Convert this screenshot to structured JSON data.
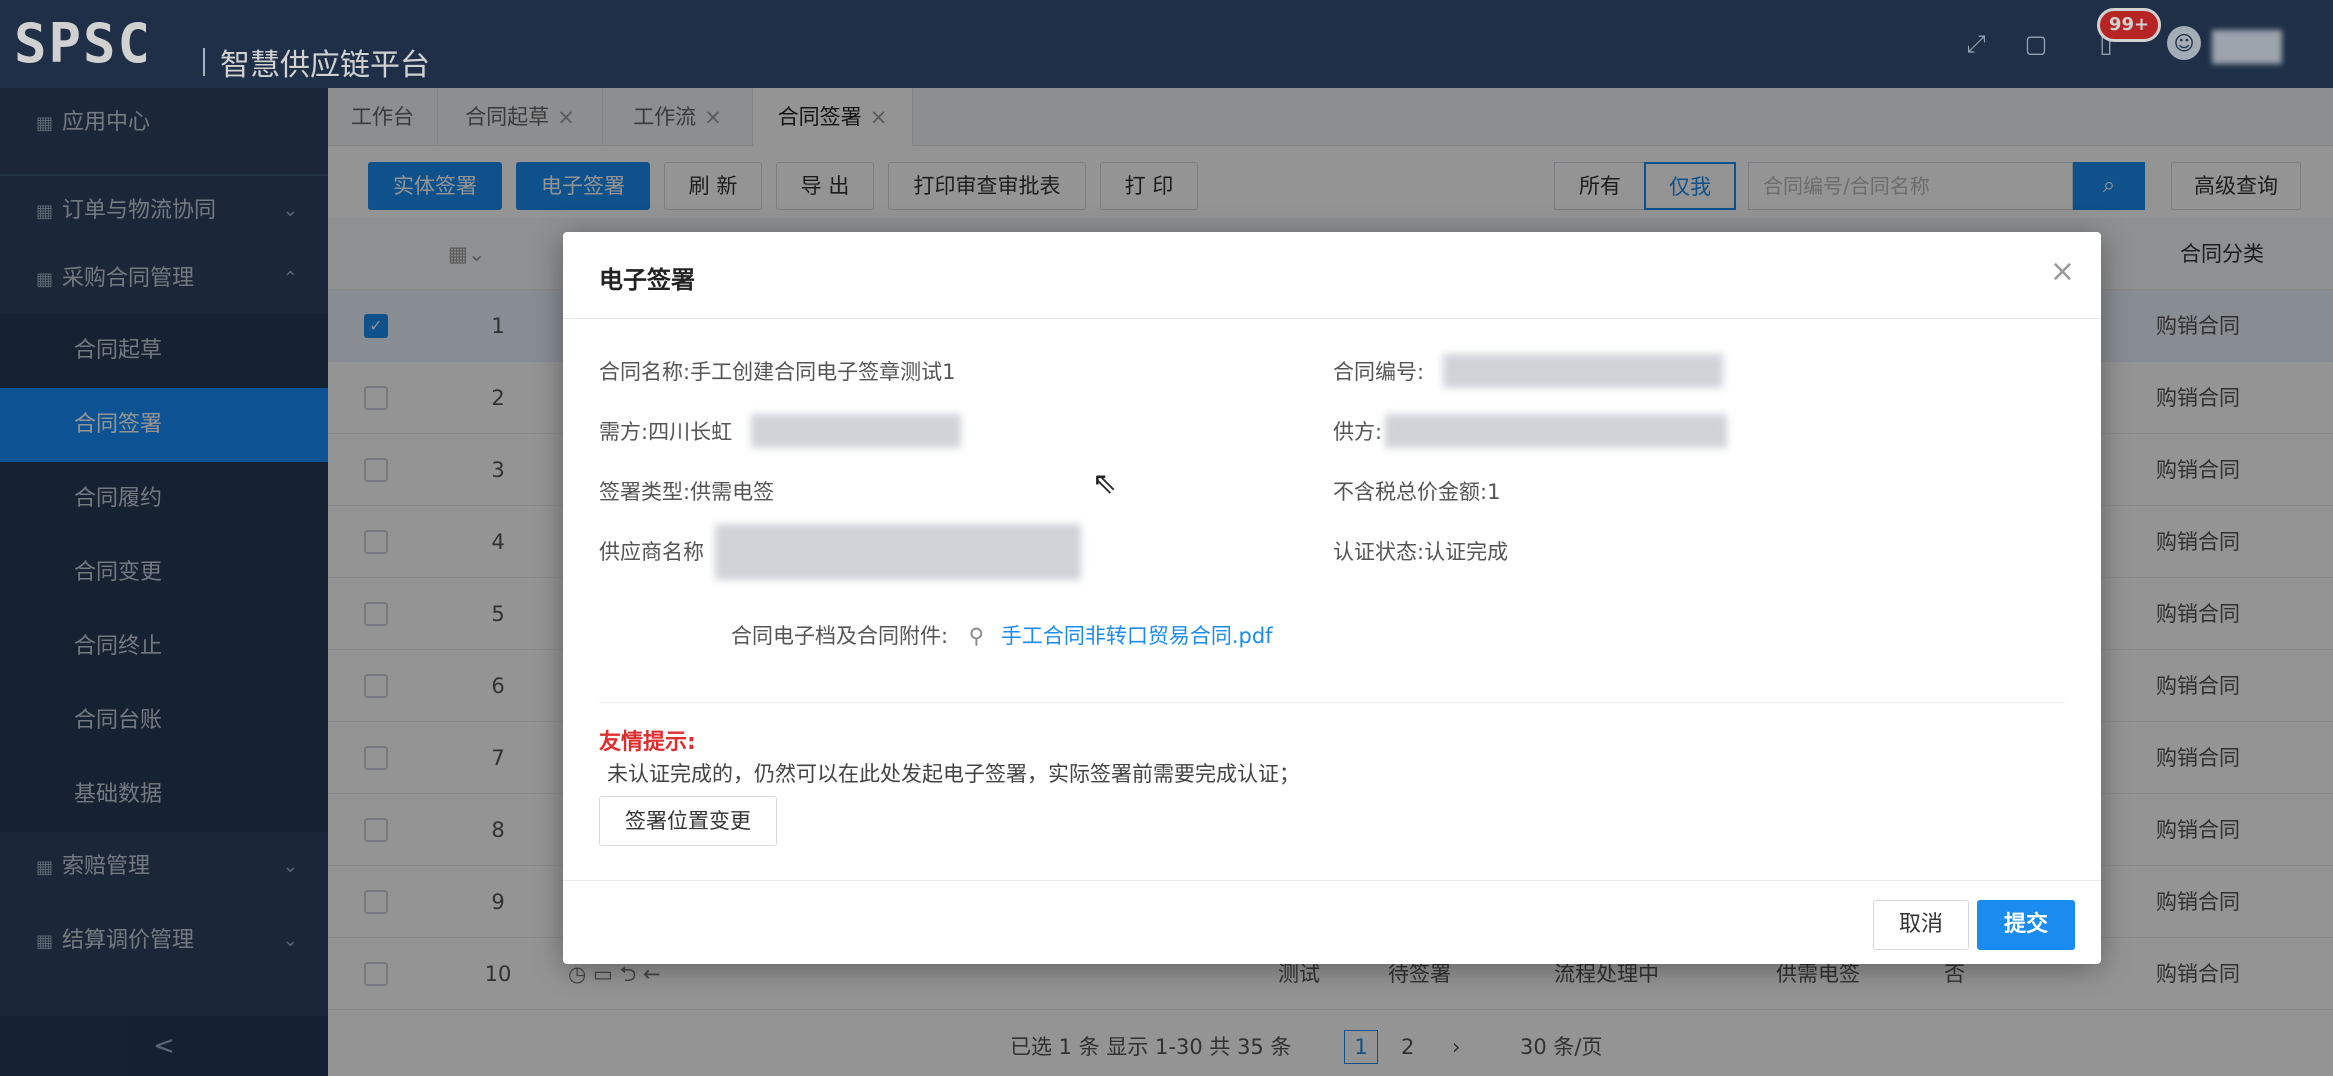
{
  "header": {
    "logo": "SPSC",
    "platform": "智慧供应链平台",
    "notification_count": "99+"
  },
  "sidebar": {
    "app_center": "应用中心",
    "order_logistics": "订单与物流协同",
    "purchase_contract": "采购合同管理",
    "items": [
      "合同起草",
      "合同签署",
      "合同履约",
      "合同变更",
      "合同终止",
      "合同台账",
      "基础数据"
    ],
    "claims": "索赔管理",
    "settlement": "结算调价管理",
    "collapse": "<"
  },
  "tabs": [
    {
      "label": "工作台"
    },
    {
      "label": "合同起草"
    },
    {
      "label": "工作流"
    },
    {
      "label": "合同签署"
    }
  ],
  "toolbar": {
    "physical_sign": "实体签署",
    "electronic_sign": "电子签署",
    "refresh": "刷 新",
    "export": "导 出",
    "print_approval": "打印审查审批表",
    "print": "打 印",
    "all": "所有",
    "only_me": "仅我",
    "search_placeholder": "合同编号/合同名称",
    "advanced": "高级查询"
  },
  "grid": {
    "category_header": "合同分类",
    "rows": [
      {
        "idx": "1",
        "category": "购销合同"
      },
      {
        "idx": "2",
        "category": "购销合同"
      },
      {
        "idx": "3",
        "category": "购销合同"
      },
      {
        "idx": "4",
        "category": "购销合同"
      },
      {
        "idx": "5",
        "category": "购销合同"
      },
      {
        "idx": "6",
        "category": "购销合同"
      },
      {
        "idx": "7",
        "category": "购销合同"
      },
      {
        "idx": "8",
        "category": "购销合同"
      },
      {
        "idx": "9",
        "category": "购销合同"
      },
      {
        "idx": "10",
        "category": "购销合同"
      }
    ],
    "row10": {
      "name_suffix": "测试",
      "status": "待签署",
      "flow": "流程处理中",
      "sign_type": "供需电签",
      "flag": "否"
    }
  },
  "pager": {
    "summary": "已选 1 条 显示 1-30 共 35 条",
    "page1": "1",
    "page2": "2",
    "per_page": "30 条/页"
  },
  "modal": {
    "title": "电子签署",
    "contract_name_label": "合同名称:",
    "contract_name": "手工创建合同电子签章测试1",
    "contract_no_label": "合同编号:",
    "demand_label": "需方:",
    "demand_value": "四川长虹",
    "supply_label": "供方:",
    "sign_type_label": "签署类型:",
    "sign_type": "供需电签",
    "amount_label": "不含税总价金额:",
    "amount": "1",
    "supplier_name_label": "供应商名称",
    "cert_label": "认证状态:",
    "cert_value": "认证完成",
    "attach_label": "合同电子档及合同附件:",
    "attach_file": "手工合同非转口贸易合同.pdf",
    "tip_title": "友情提示:",
    "tip_text": "未认证完成的，仍然可以在此处发起电子签署，实际签署前需要完成认证；",
    "pos_change": "签署位置变更",
    "cancel": "取消",
    "submit": "提交"
  }
}
